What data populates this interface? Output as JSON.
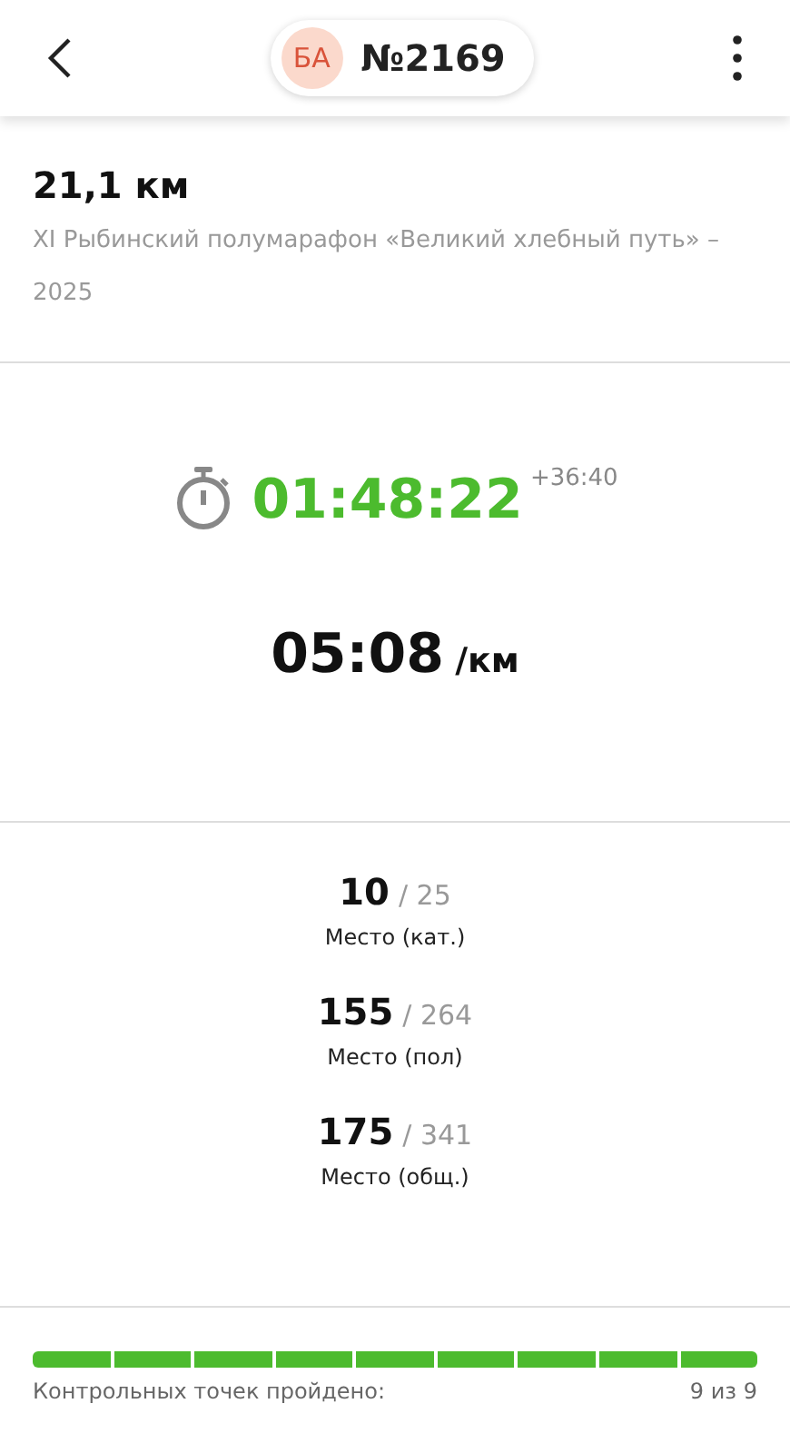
{
  "header": {
    "avatar_initials": "БА",
    "bib": "№2169"
  },
  "race": {
    "distance": "21,1 км",
    "name": "XI Рыбинский полумарафон «Великий хлебный путь» – 2025"
  },
  "result": {
    "time": "01:48:22",
    "gap": "+36:40",
    "pace": "05:08",
    "pace_unit": "/км"
  },
  "places": [
    {
      "place": "10",
      "total": "/ 25",
      "label": "Место (кат.)"
    },
    {
      "place": "155",
      "total": "/ 264",
      "label": "Место (пол)"
    },
    {
      "place": "175",
      "total": "/ 341",
      "label": "Место (общ.)"
    }
  ],
  "checkpoints": {
    "segments": [
      {
        "passed": true
      },
      {
        "passed": true
      },
      {
        "passed": true
      },
      {
        "passed": true
      },
      {
        "passed": true
      },
      {
        "passed": true
      },
      {
        "passed": true
      },
      {
        "passed": true
      },
      {
        "passed": true
      }
    ],
    "label": "Контрольных точек пройдено:",
    "count": "9 из 9"
  }
}
